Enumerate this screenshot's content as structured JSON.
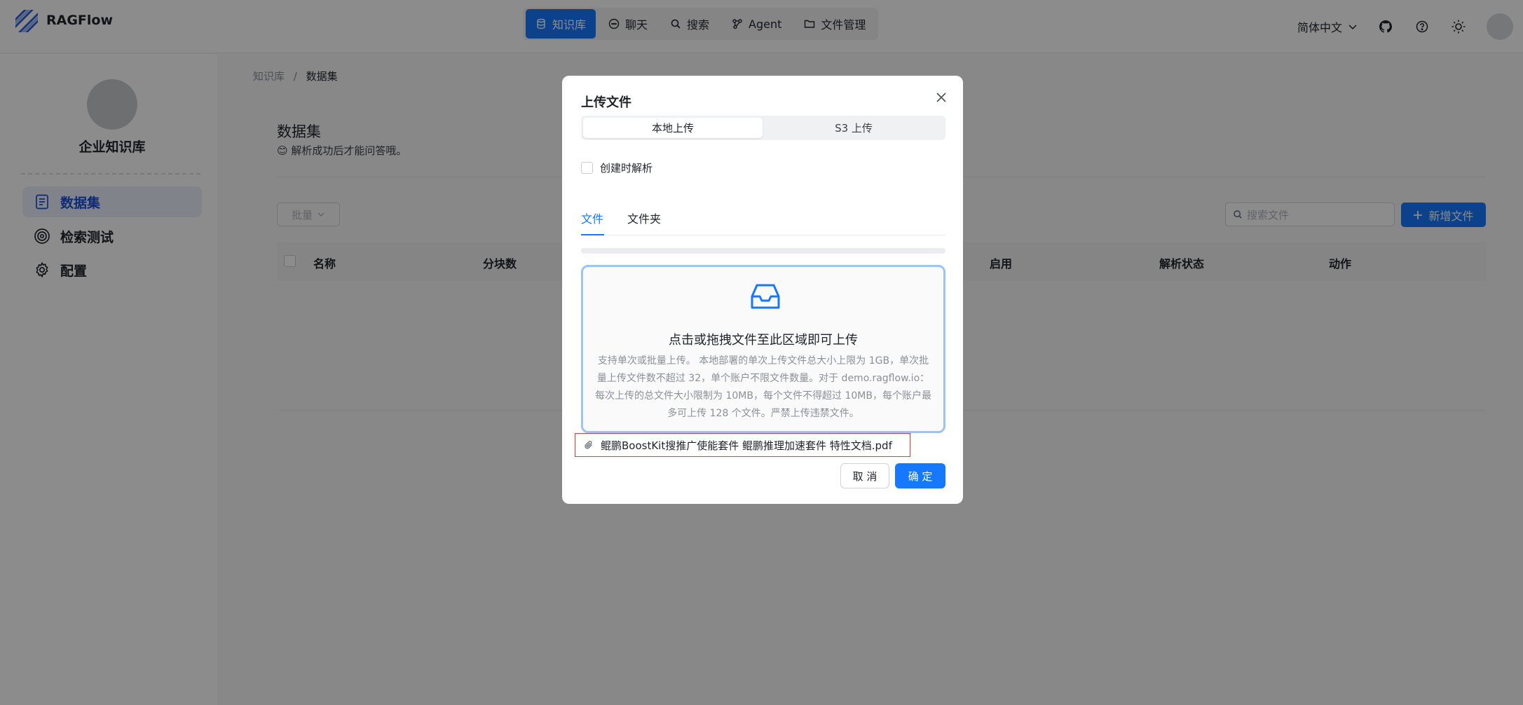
{
  "header": {
    "brand": "RAGFlow",
    "nav": [
      {
        "label": "知识库",
        "icon": "database-icon",
        "active": true
      },
      {
        "label": "聊天",
        "icon": "chat-icon"
      },
      {
        "label": "搜索",
        "icon": "search-icon"
      },
      {
        "label": "Agent",
        "icon": "agent-icon"
      },
      {
        "label": "文件管理",
        "icon": "folder-icon"
      }
    ],
    "language": "简体中文"
  },
  "sidebar": {
    "kb_name": "企业知识库",
    "items": [
      {
        "label": "数据集",
        "icon": "document-icon",
        "active": true
      },
      {
        "label": "检索测试",
        "icon": "target-icon"
      },
      {
        "label": "配置",
        "icon": "gear-icon"
      }
    ]
  },
  "main": {
    "breadcrumb": {
      "root": "知识库",
      "sep": "/",
      "current": "数据集"
    },
    "title": "数据集",
    "subtitle": "😊 解析成功后才能问答哦。",
    "batch_label": "批量",
    "search_placeholder": "搜索文件",
    "new_file_label": "新增文件",
    "columns": [
      "名称",
      "分块数",
      "启用",
      "解析状态",
      "动作"
    ]
  },
  "modal": {
    "title": "上传文件",
    "segments": [
      "本地上传",
      "S3 上传"
    ],
    "parse_on_create": "创建时解析",
    "tabs": [
      "文件",
      "文件夹"
    ],
    "dropzone_title": "点击或拖拽文件至此区域即可上传",
    "dropzone_hint": "支持单次或批量上传。 本地部署的单次上传文件总大小上限为 1GB，单次批量上传文件数不超过 32，单个账户不限文件数量。对于 demo.ragflow.io：每次上传的总文件大小限制为 10MB，每个文件不得超过 10MB，每个账户最多可上传 128 个文件。严禁上传违禁文件。",
    "file_name": "鲲鹏BoostKit搜推广使能套件 鲲鹏推理加速套件 特性文档.pdf",
    "cancel_label": "取 消",
    "ok_label": "确 定",
    "accent": "#1677ff"
  }
}
